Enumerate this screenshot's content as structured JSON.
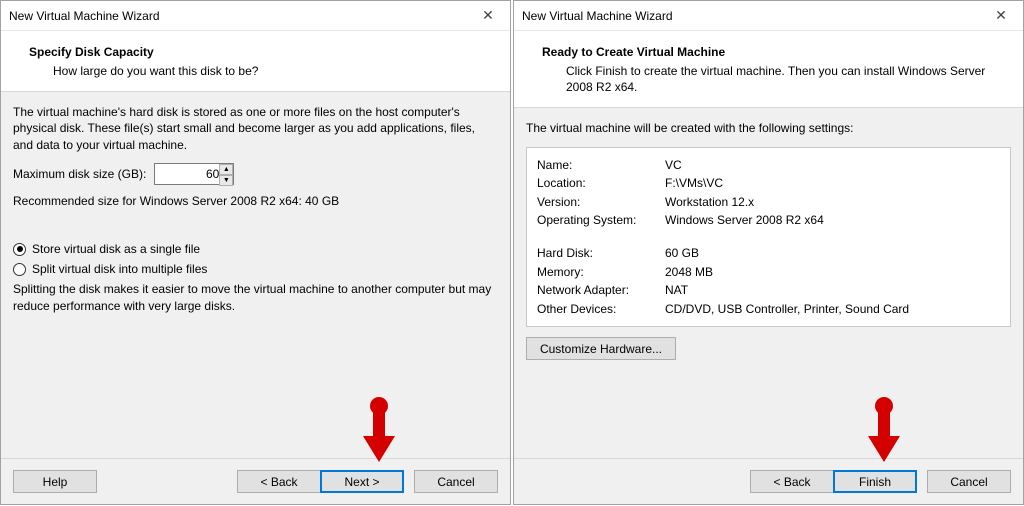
{
  "left": {
    "window_title": "New Virtual Machine Wizard",
    "header_title": "Specify Disk Capacity",
    "header_sub": "How large do you want this disk to be?",
    "body_intro": "The virtual machine's hard disk is stored as one or more files on the host computer's physical disk. These file(s) start small and become larger as you add applications, files, and data to your virtual machine.",
    "max_label": "Maximum disk size (GB):",
    "max_value": "60",
    "recommended": "Recommended size for Windows Server 2008 R2 x64: 40 GB",
    "radio_single": "Store virtual disk as a single file",
    "radio_split": "Split virtual disk into multiple files",
    "split_hint": "Splitting the disk makes it easier to move the virtual machine to another computer but may reduce performance with very large disks.",
    "buttons": {
      "help": "Help",
      "back": "< Back",
      "next": "Next >",
      "cancel": "Cancel"
    }
  },
  "right": {
    "window_title": "New Virtual Machine Wizard",
    "header_title": "Ready to Create Virtual Machine",
    "header_sub": "Click Finish to create the virtual machine. Then you can install Windows Server 2008 R2 x64.",
    "lead": "The virtual machine will be created with the following settings:",
    "summary": [
      {
        "k": "Name:",
        "v": "VC"
      },
      {
        "k": "Location:",
        "v": "F:\\VMs\\VC"
      },
      {
        "k": "Version:",
        "v": "Workstation 12.x"
      },
      {
        "k": "Operating System:",
        "v": "Windows Server 2008 R2 x64"
      }
    ],
    "summary2": [
      {
        "k": "Hard Disk:",
        "v": "60 GB"
      },
      {
        "k": "Memory:",
        "v": "2048 MB"
      },
      {
        "k": "Network Adapter:",
        "v": "NAT"
      },
      {
        "k": "Other Devices:",
        "v": "CD/DVD, USB Controller, Printer, Sound Card"
      }
    ],
    "customize": "Customize Hardware...",
    "buttons": {
      "back": "< Back",
      "finish": "Finish",
      "cancel": "Cancel"
    }
  }
}
